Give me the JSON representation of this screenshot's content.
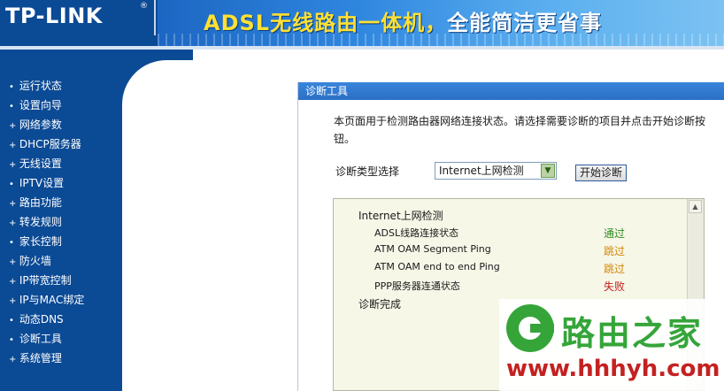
{
  "header": {
    "logo": "TP-LINK",
    "logo_reg": "®",
    "slogan_part1": "ADSL无线路由一体机，",
    "slogan_part2": "全能简洁更省事"
  },
  "sidebar": {
    "items": [
      {
        "label": "运行状态",
        "bullet": "•"
      },
      {
        "label": "设置向导",
        "bullet": "•"
      },
      {
        "label": "网络参数",
        "bullet": "+"
      },
      {
        "label": "DHCP服务器",
        "bullet": "+"
      },
      {
        "label": "无线设置",
        "bullet": "+"
      },
      {
        "label": "IPTV设置",
        "bullet": "•"
      },
      {
        "label": "路由功能",
        "bullet": "+"
      },
      {
        "label": "转发规则",
        "bullet": "+"
      },
      {
        "label": "家长控制",
        "bullet": "•"
      },
      {
        "label": "防火墙",
        "bullet": "+"
      },
      {
        "label": "IP带宽控制",
        "bullet": "+"
      },
      {
        "label": "IP与MAC绑定",
        "bullet": "+"
      },
      {
        "label": "动态DNS",
        "bullet": "•"
      },
      {
        "label": "诊断工具",
        "bullet": "•"
      },
      {
        "label": "系统管理",
        "bullet": "+"
      }
    ]
  },
  "panel": {
    "title": "诊断工具",
    "description": "本页面用于检测路由器网络连接状态。请选择需要诊断的项目并点击开始诊断按钮。",
    "type_label": "诊断类型选择",
    "select_value": "Internet上网检测",
    "start_button": "开始诊断"
  },
  "result": {
    "title": "Internet上网检测",
    "rows": [
      {
        "name": "ADSL线路连接状态",
        "status": "通过",
        "status_class": "pass"
      },
      {
        "name": "ATM OAM Segment Ping",
        "status": "跳过",
        "status_class": "skip"
      },
      {
        "name": "ATM OAM end to end Ping",
        "status": "跳过",
        "status_class": "skip"
      },
      {
        "name": "PPP服务器连通状态",
        "status": "失败",
        "status_class": "fail"
      }
    ],
    "done": "诊断完成"
  },
  "watermark": {
    "title": "路由之家",
    "url": "www.hhhyh.com"
  },
  "colors": {
    "nav_blue": "#0b4a95",
    "pass": "#2e8b1e",
    "skip": "#d48806",
    "fail": "#c41e1e"
  }
}
